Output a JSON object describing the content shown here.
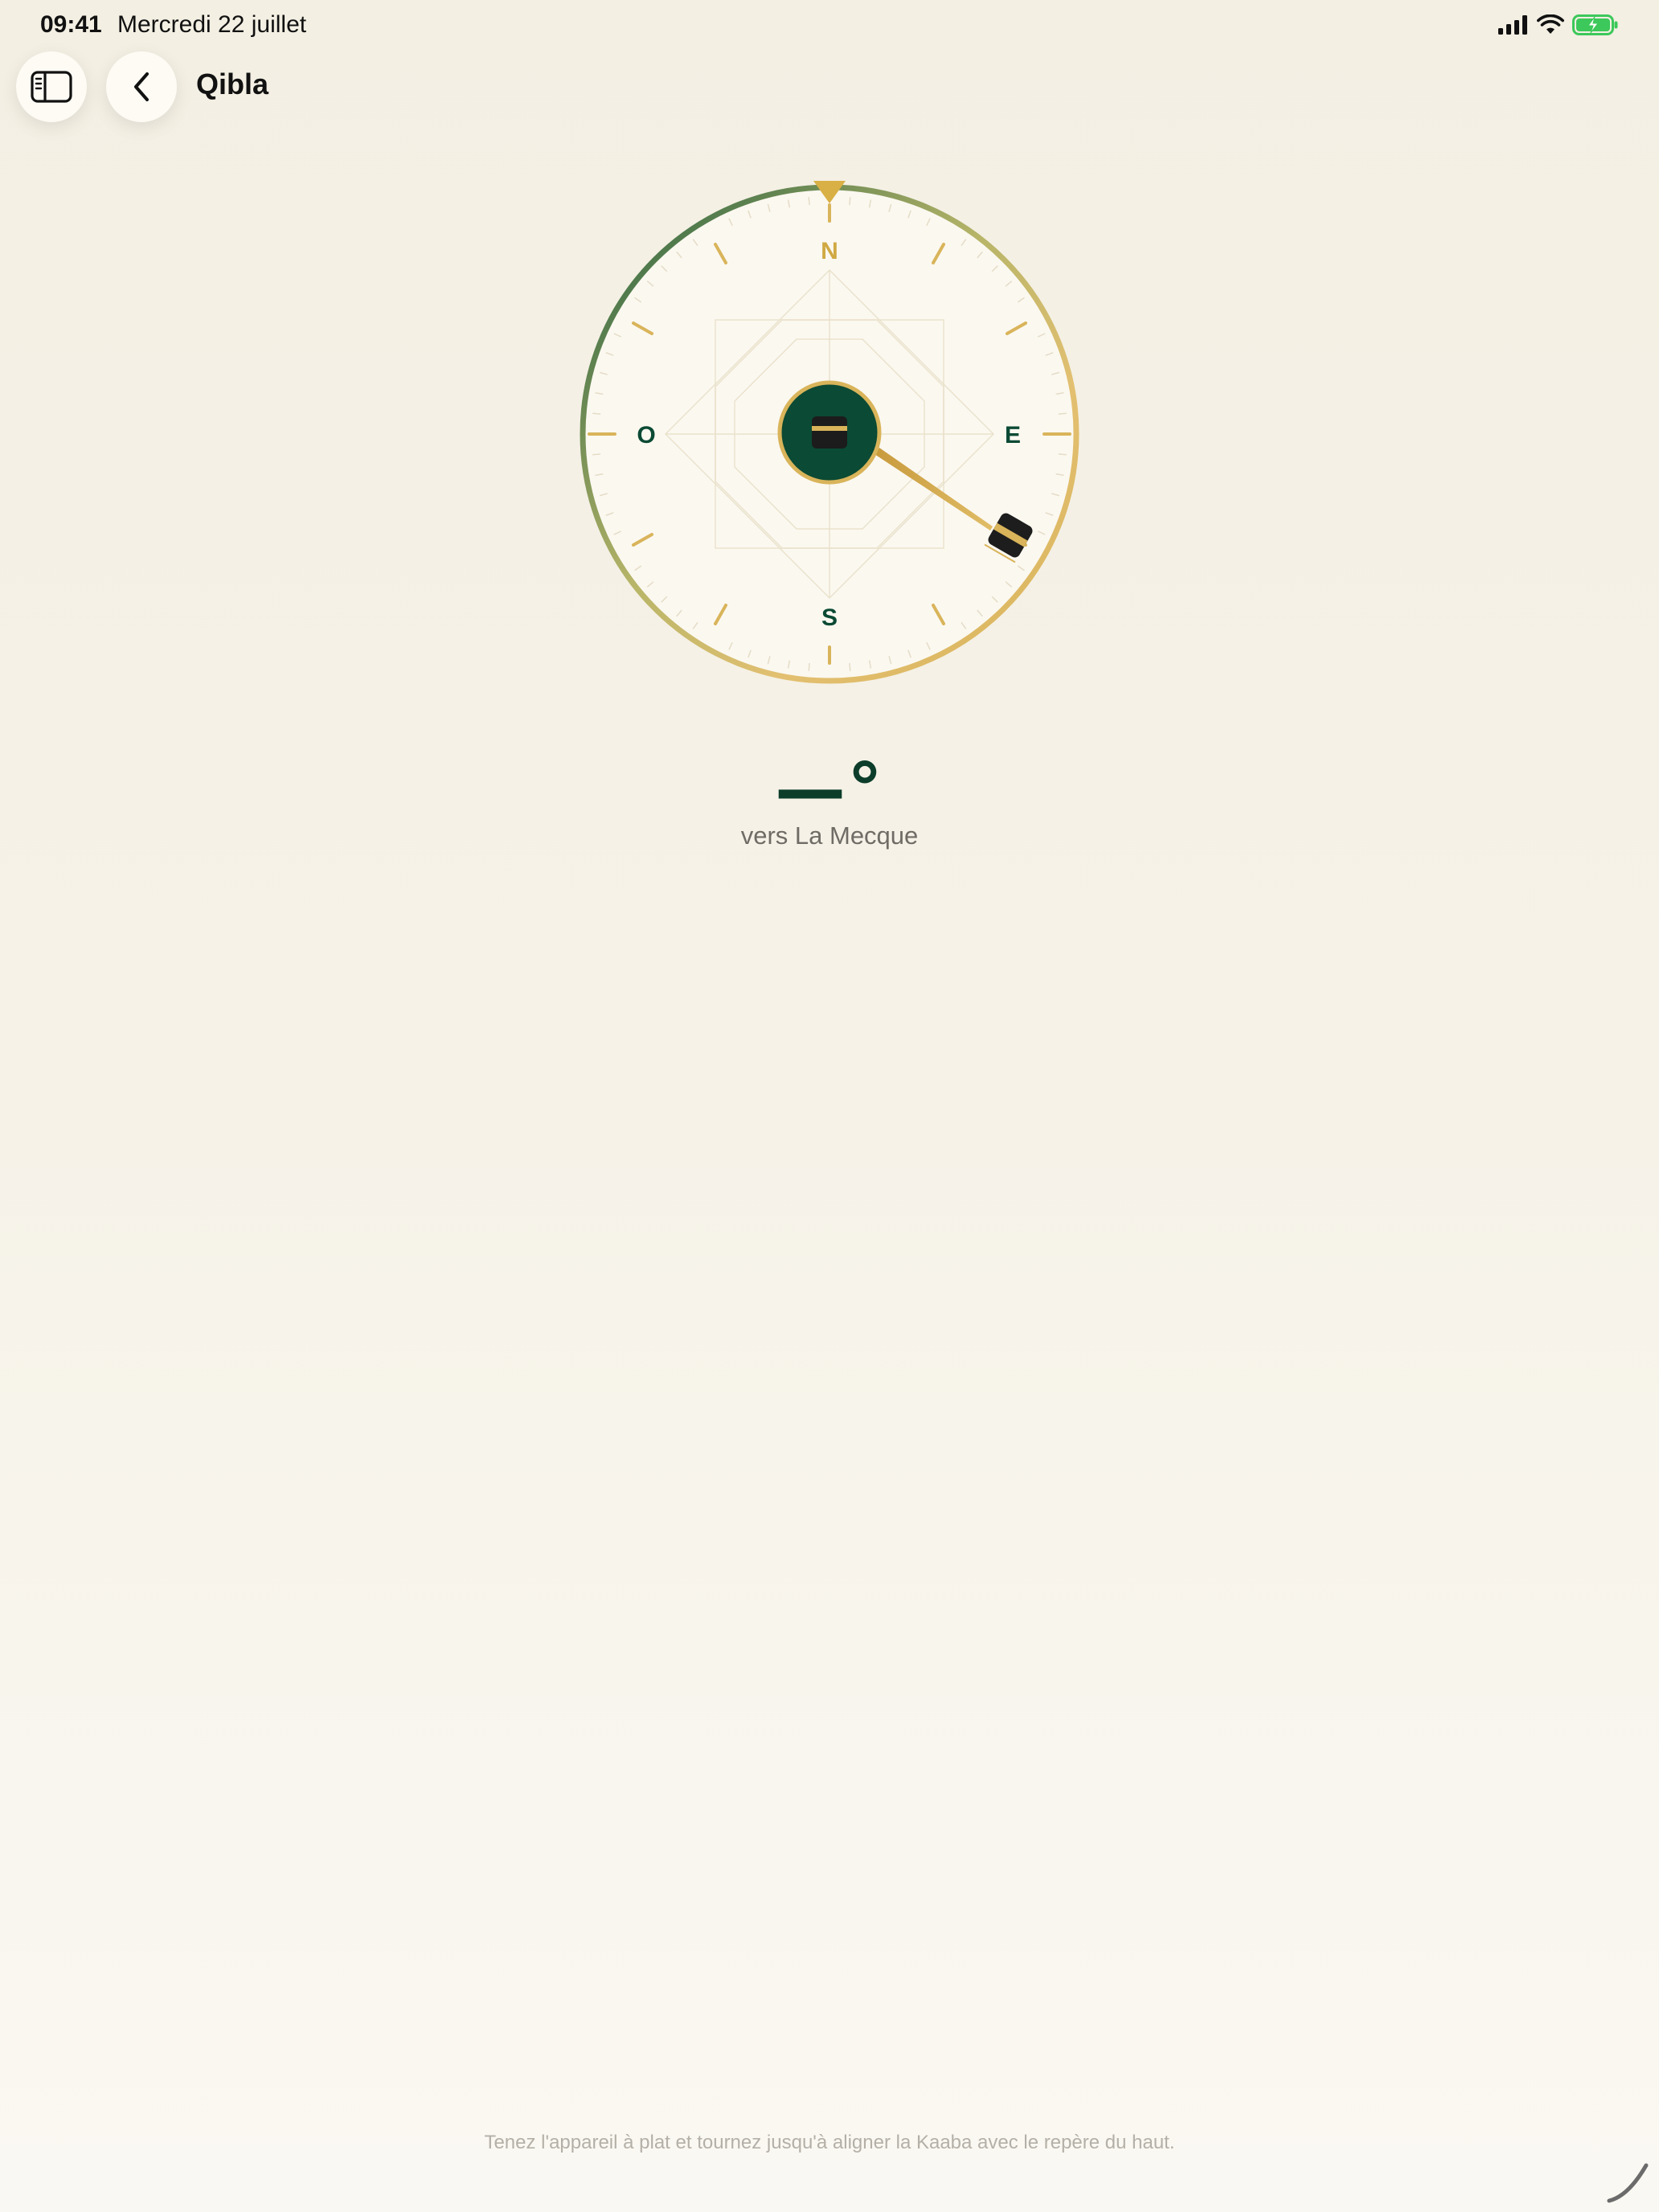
{
  "status_bar": {
    "time": "09:41",
    "date": "Mercredi 22 juillet",
    "icons": [
      "cellular-signal-icon",
      "wifi-icon",
      "battery-charging-icon"
    ]
  },
  "nav": {
    "sidebar_toggle_icon": "sidebar-icon",
    "back_icon": "chevron-left-icon",
    "title": "Qibla"
  },
  "compass": {
    "north": "N",
    "east": "E",
    "south": "S",
    "west": "O",
    "center_icon": "kaaba-icon",
    "needle_icon": "kaaba-icon",
    "qibla_bearing_deg": 119
  },
  "heading": {
    "value": "—°",
    "label": "vers La Mecque"
  },
  "hint": "Tenez l'appareil à plat et tournez jusqu'à aligner la Kaaba avec le repère du haut.",
  "colors": {
    "dark_green": "#0b4a34",
    "gold": "#d9b45a",
    "ring_green": "#2f6b4c",
    "background": "#f5f1e6",
    "battery_green": "#3cc85a"
  }
}
